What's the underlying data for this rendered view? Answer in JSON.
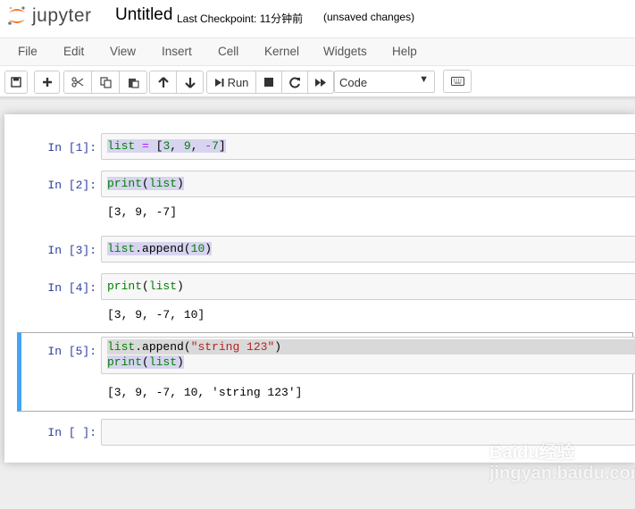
{
  "header": {
    "logo_text": "jupyter",
    "notebook_name": "Untitled",
    "checkpoint": "Last Checkpoint: 11分钟前",
    "autosave_status": "(unsaved changes)"
  },
  "menu": [
    "File",
    "Edit",
    "View",
    "Insert",
    "Cell",
    "Kernel",
    "Widgets",
    "Help"
  ],
  "toolbar": {
    "run_label": "Run",
    "cell_type": "Code",
    "cell_type_options": [
      "Code"
    ]
  },
  "cells": [
    {
      "prompt": "In [1]:",
      "code": [
        "list = [3, 9, -7]"
      ],
      "output": ""
    },
    {
      "prompt": "In [2]:",
      "code": [
        "print(list)"
      ],
      "output": "[3, 9, -7]"
    },
    {
      "prompt": "In [3]:",
      "code": [
        "list.append(10)"
      ],
      "output": ""
    },
    {
      "prompt": "In [4]:",
      "code": [
        "print(list)"
      ],
      "output": "[3, 9, -7, 10]"
    },
    {
      "prompt": "In [5]:",
      "code": [
        "list.append(\"string 123\")",
        "print(list)"
      ],
      "output": "[3, 9, -7, 10, 'string 123']"
    },
    {
      "prompt": "In [ ]:",
      "code": [
        ""
      ],
      "output": ""
    }
  ],
  "colors": {
    "prompt_in": "#303f9f",
    "selected_cell_border": "#42a5f5",
    "logo_orange": "#f37726"
  },
  "watermark": "Baidu经验 jingyan.baidu.com"
}
